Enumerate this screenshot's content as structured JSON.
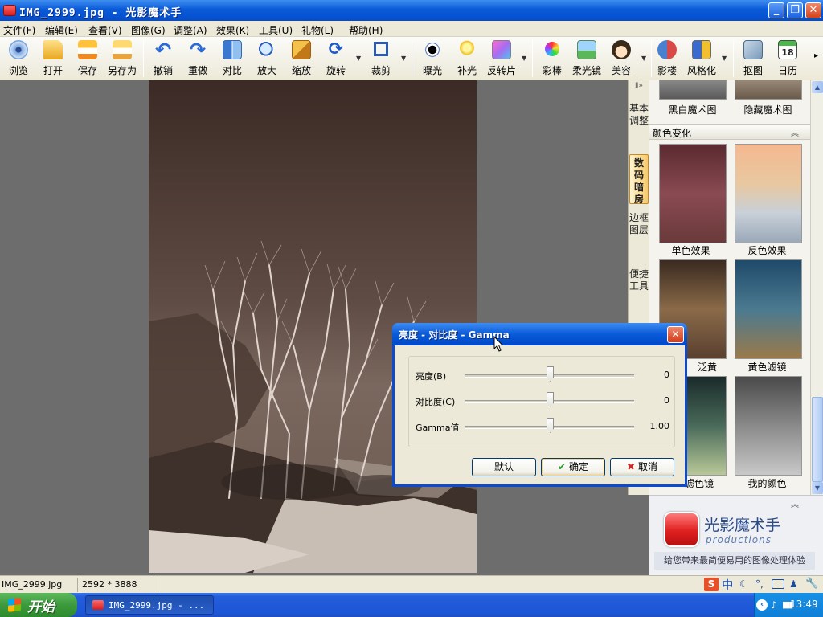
{
  "window": {
    "title": "IMG_2999.jpg - 光影魔术手",
    "minimize": "_",
    "restore": "❐",
    "close": "✕"
  },
  "menu": [
    "文件(F)",
    "编辑(E)",
    "查看(V)",
    "图像(G)",
    "调整(A)",
    "效果(K)",
    "工具(U)",
    "礼物(L)",
    "帮助(H)"
  ],
  "toolbar": [
    {
      "label": "浏览",
      "icon": "browse-icon"
    },
    {
      "label": "打开",
      "icon": "folder-icon"
    },
    {
      "label": "保存",
      "icon": "save-icon"
    },
    {
      "label": "另存为",
      "icon": "save-as-icon"
    },
    {
      "label": "撤销",
      "icon": "undo-icon"
    },
    {
      "label": "重做",
      "icon": "redo-icon"
    },
    {
      "label": "对比",
      "icon": "compare-icon"
    },
    {
      "label": "放大",
      "icon": "zoom-in-icon"
    },
    {
      "label": "缩放",
      "icon": "resize-icon"
    },
    {
      "label": "旋转",
      "icon": "rotate-icon"
    },
    {
      "label": "裁剪",
      "icon": "crop-icon"
    },
    {
      "label": "曝光",
      "icon": "exposure-icon"
    },
    {
      "label": "补光",
      "icon": "fill-light-icon"
    },
    {
      "label": "反转片",
      "icon": "reversal-film-icon"
    },
    {
      "label": "彩棒",
      "icon": "color-wand-icon"
    },
    {
      "label": "柔光镜",
      "icon": "soft-focus-icon"
    },
    {
      "label": "美容",
      "icon": "beauty-icon"
    },
    {
      "label": "影楼",
      "icon": "studio-icon"
    },
    {
      "label": "风格化",
      "icon": "stylize-icon"
    },
    {
      "label": "抠图",
      "icon": "cutout-icon"
    },
    {
      "label": "日历",
      "icon": "calendar-icon",
      "calendar_day": "18"
    }
  ],
  "vtabs": [
    "基本调整",
    "数码暗房",
    "边框图层",
    "便捷工具"
  ],
  "vtabs_arrow": "Ⅱ»",
  "panel": {
    "top_items": [
      "黑白魔术图",
      "隐藏魔术图"
    ],
    "section_title": "颜色变化",
    "section_collapse": "︽",
    "effects": [
      "单色效果",
      "反色效果",
      "泛黄",
      "黄色滤镜",
      "滤色镜",
      "我的颜色"
    ],
    "bottom_collapse": "︽"
  },
  "promo": {
    "brand": "光影魔术手",
    "sub": "productions",
    "tagline": "给您带来最简便易用的图像处理体验"
  },
  "status": {
    "file": "IMG_2999.jpg",
    "dimensions": "2592 * 3888"
  },
  "dialog": {
    "title": "亮度 - 对比度 - Gamma",
    "close": "✕",
    "sliders": [
      {
        "label": "亮度(B)",
        "value": "0",
        "position": 0.5
      },
      {
        "label": "对比度(C)",
        "value": "0",
        "position": 0.5
      },
      {
        "label": "Gamma值",
        "value": "1.00",
        "position": 0.5
      }
    ],
    "buttons": {
      "default": "默认",
      "ok": "确定",
      "cancel": "取消"
    }
  },
  "taskbar": {
    "start": "开始",
    "item": "IMG_2999.jpg - ...",
    "clock": "13:49",
    "ime": "中"
  },
  "colors": {
    "titlebar": "#0a5ad8",
    "taskbar": "#245edb",
    "start_green": "#3c9a3c",
    "active_tab": "#f5c96a"
  }
}
